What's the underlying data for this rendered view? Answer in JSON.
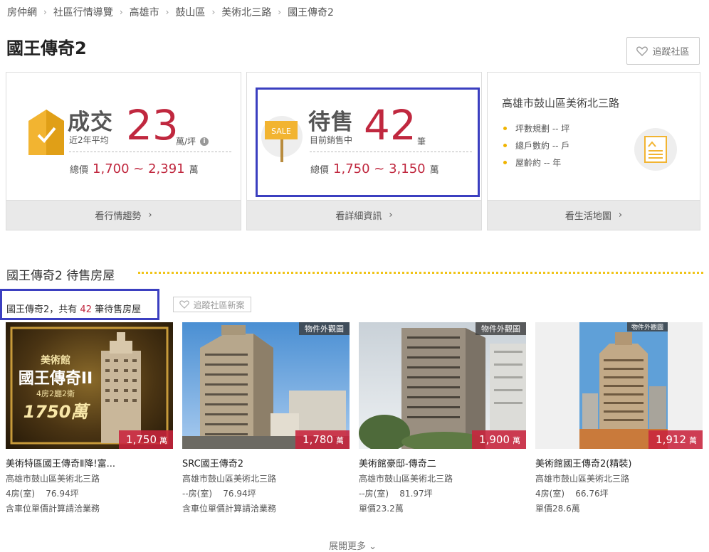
{
  "breadcrumb": [
    "房仲網",
    "社區行情導覽",
    "高雄市",
    "鼓山區",
    "美術北三路",
    "國王傳奇2"
  ],
  "page_title": "國王傳奇2",
  "follow_button": "追蹤社區",
  "sold_card": {
    "label": "成交",
    "sublabel": "近2年平均",
    "value": "23",
    "unit": "萬/坪",
    "range_prefix": "總價",
    "range_value": "1,700 ~ 2,391",
    "range_unit": "萬",
    "footer": "看行情趨勢"
  },
  "sale_card": {
    "icon_text": "SALE",
    "label": "待售",
    "sublabel": "目前銷售中",
    "value": "42",
    "unit": "筆",
    "range_prefix": "總價",
    "range_value": "1,750 ~ 3,150",
    "range_unit": "萬",
    "footer": "看詳細資訊"
  },
  "info_card": {
    "address": "高雄市鼓山區美術北三路",
    "bullets": [
      "坪數規劃 -- 坪",
      "總戶數約 -- 戶",
      "屋齡約 -- 年"
    ],
    "footer": "看生活地圖"
  },
  "section_title": "國王傳奇2 待售房屋",
  "count_text": {
    "prefix": "國王傳奇2，共有",
    "count": "42",
    "suffix": "筆待售房屋"
  },
  "follow_new": "追蹤社區新案",
  "listings": [
    {
      "title": "美術特區國王傳奇Ⅱ降!富...",
      "address": "高雄市鼓山區美術北三路",
      "rooms": "4房(室)",
      "area": "76.94坪",
      "note": "含車位單價計算請洽業務",
      "price": "1,750",
      "price_unit": "萬",
      "tag": "",
      "photo_text": [
        "美術館",
        "國王傳奇II",
        "4房2廳2衛",
        "1750萬"
      ]
    },
    {
      "title": "SRC國王傳奇2",
      "address": "高雄市鼓山區美術北三路",
      "rooms": "--房(室)",
      "area": "76.94坪",
      "note": "含車位單價計算請洽業務",
      "price": "1,780",
      "price_unit": "萬",
      "tag": "物件外觀圖"
    },
    {
      "title": "美術館豪邸-傳奇二",
      "address": "高雄市鼓山區美術北三路",
      "rooms": "--房(室)",
      "area": "81.97坪",
      "note": "單價23.2萬",
      "price": "1,900",
      "price_unit": "萬",
      "tag": "物件外觀圖"
    },
    {
      "title": "美術館國王傳奇2(精裝)",
      "address": "高雄市鼓山區美術北三路",
      "rooms": "4房(室)",
      "area": "66.76坪",
      "note": "單價28.6萬",
      "price": "1,912",
      "price_unit": "萬",
      "tag": "物件外觀圖"
    }
  ],
  "more_label": "展開更多"
}
